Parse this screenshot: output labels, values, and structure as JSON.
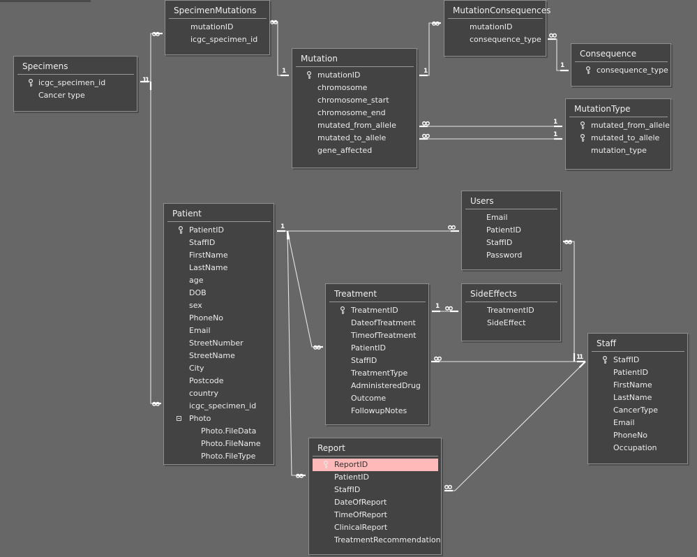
{
  "tables": [
    {
      "name": "Specimens",
      "fields": [
        {
          "label": "icgc_specimen_id",
          "key": true
        },
        {
          "label": "Cancer type"
        }
      ]
    },
    {
      "name": "SpecimenMutations",
      "fields": [
        {
          "label": "mutationID"
        },
        {
          "label": "icgc_specimen_id"
        }
      ]
    },
    {
      "name": "Mutation",
      "fields": [
        {
          "label": "mutationID",
          "key": true
        },
        {
          "label": "chromosome"
        },
        {
          "label": "chromosome_start"
        },
        {
          "label": "chromosome_end"
        },
        {
          "label": "mutated_from_allele"
        },
        {
          "label": "mutated_to_allele"
        },
        {
          "label": "gene_affected"
        }
      ]
    },
    {
      "name": "MutationConsequences",
      "fields": [
        {
          "label": "mutationID"
        },
        {
          "label": "consequence_type"
        }
      ]
    },
    {
      "name": "Consequence",
      "fields": [
        {
          "label": "consequence_type",
          "key": true
        }
      ]
    },
    {
      "name": "MutationType",
      "fields": [
        {
          "label": "mutated_from_allele",
          "key": true
        },
        {
          "label": "mutated_to_allele",
          "key": true
        },
        {
          "label": "mutation_type"
        }
      ]
    },
    {
      "name": "Patient",
      "fields": [
        {
          "label": "PatientID",
          "key": true
        },
        {
          "label": "StaffID"
        },
        {
          "label": "FirstName"
        },
        {
          "label": "LastName"
        },
        {
          "label": "age"
        },
        {
          "label": "DOB"
        },
        {
          "label": "sex"
        },
        {
          "label": "PhoneNo"
        },
        {
          "label": "Email"
        },
        {
          "label": "StreetNumber"
        },
        {
          "label": "StreetName"
        },
        {
          "label": "City"
        },
        {
          "label": "Postcode"
        },
        {
          "label": "country"
        },
        {
          "label": "icgc_specimen_id"
        },
        {
          "label": "Photo",
          "expander": true
        },
        {
          "label": "Photo.FileData",
          "indent": true
        },
        {
          "label": "Photo.FileName",
          "indent": true
        },
        {
          "label": "Photo.FileType",
          "indent": true
        }
      ]
    },
    {
      "name": "Users",
      "fields": [
        {
          "label": "Email"
        },
        {
          "label": "PatientID"
        },
        {
          "label": "StaffID"
        },
        {
          "label": "Password"
        }
      ]
    },
    {
      "name": "Treatment",
      "fields": [
        {
          "label": "TreatmentID",
          "key": true
        },
        {
          "label": "DateofTreatment"
        },
        {
          "label": "TimeofTreatment"
        },
        {
          "label": "PatientID"
        },
        {
          "label": "StaffID"
        },
        {
          "label": "TreatmentType"
        },
        {
          "label": "AdministeredDrug"
        },
        {
          "label": "Outcome"
        },
        {
          "label": "FollowupNotes"
        }
      ]
    },
    {
      "name": "SideEffects",
      "fields": [
        {
          "label": "TreatmentID"
        },
        {
          "label": "SideEffect"
        }
      ]
    },
    {
      "name": "Staff",
      "fields": [
        {
          "label": "StaffID",
          "key": true
        },
        {
          "label": "PatientID"
        },
        {
          "label": "FirstName"
        },
        {
          "label": "LastName"
        },
        {
          "label": "CancerType"
        },
        {
          "label": "Email"
        },
        {
          "label": "PhoneNo"
        },
        {
          "label": "Occupation"
        }
      ]
    },
    {
      "name": "Report",
      "fields": [
        {
          "label": "ReportID",
          "key": true,
          "highlight": true
        },
        {
          "label": "PatientID"
        },
        {
          "label": "StaffID"
        },
        {
          "label": "DateOfReport"
        },
        {
          "label": "TimeOfReport"
        },
        {
          "label": "ClinicalReport"
        },
        {
          "label": "TreatmentRecommendation"
        }
      ]
    }
  ],
  "relationships": [
    {
      "one": "Specimens",
      "many": "SpecimenMutations"
    },
    {
      "one": "Specimens",
      "many": "Patient"
    },
    {
      "one": "Mutation",
      "many": "SpecimenMutations"
    },
    {
      "one": "Mutation",
      "many": "MutationConsequences"
    },
    {
      "one": "Consequence",
      "many": "MutationConsequences"
    },
    {
      "one": "MutationType",
      "many": "Mutation",
      "via": "mutated_from_allele"
    },
    {
      "one": "MutationType",
      "many": "Mutation",
      "via": "mutated_to_allele"
    },
    {
      "one": "Patient",
      "many": "Users"
    },
    {
      "one": "Patient",
      "many": "Treatment"
    },
    {
      "one": "Patient",
      "many": "Report"
    },
    {
      "one": "Treatment",
      "many": "SideEffects"
    },
    {
      "one": "Staff",
      "many": "Treatment"
    },
    {
      "one": "Staff",
      "many": "Users"
    },
    {
      "one": "Staff",
      "many": "Report"
    }
  ],
  "cardinality": {
    "one": "1"
  },
  "colors": {
    "background": "#676767",
    "table": "#434343",
    "highlight": "#ffb9b9"
  }
}
